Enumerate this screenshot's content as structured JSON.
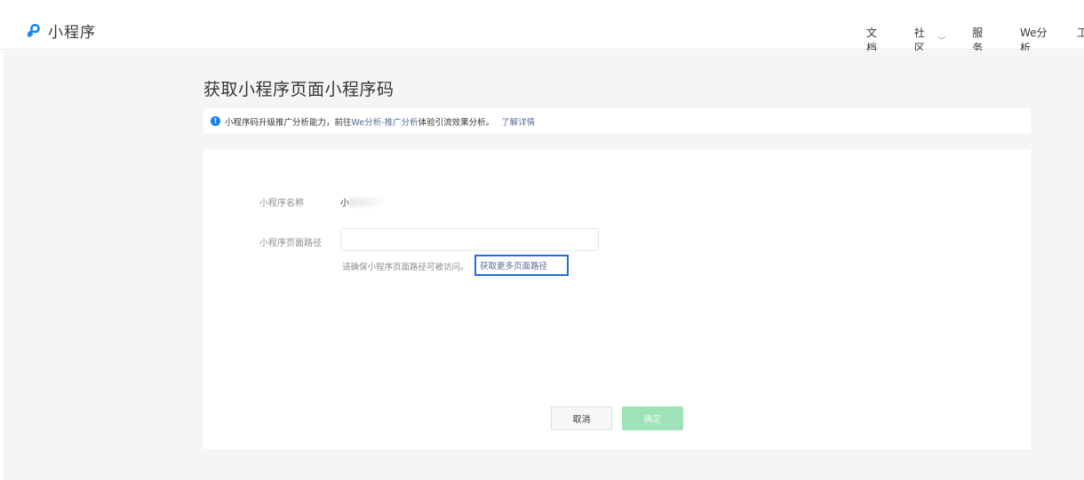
{
  "header": {
    "brand_name": "小程序",
    "nav": [
      {
        "label": "文档"
      },
      {
        "label": "社区",
        "has_dropdown": true
      },
      {
        "label": "服务"
      },
      {
        "label": "We分析"
      }
    ],
    "nav_edge_label": "工"
  },
  "page": {
    "title": "获取小程序页面小程序码"
  },
  "notice": {
    "text_before": "小程序码升级推广分析能力，前往",
    "link_text": "We分析-推广分析",
    "text_after": "体验引流效果分析。",
    "more_link": "了解详情"
  },
  "form": {
    "name_label": "小程序名称",
    "name_value_visible": "小",
    "path_label": "小程序页面路径",
    "path_value": "",
    "path_placeholder": "",
    "hint_text": "请确保小程序页面路径可被访问。",
    "hint_link": "获取更多页面路径"
  },
  "actions": {
    "cancel_label": "取消",
    "confirm_label": "确定",
    "confirm_disabled": true
  },
  "colors": {
    "accent": "#1485ee",
    "link": "#576b95",
    "highlight_border": "#1f6fd4",
    "primary_disabled": "#9ee3b8",
    "page_bg": "#f4f5f7"
  }
}
